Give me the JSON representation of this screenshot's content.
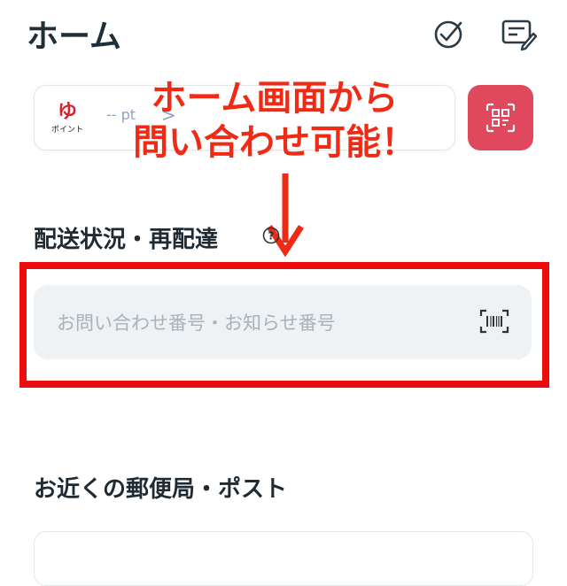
{
  "header": {
    "title": "ホーム",
    "check_icon": "check-circle-icon",
    "edit_icon": "edit-card-icon"
  },
  "points": {
    "logo_mark": "ゆ",
    "logo_text": "ポイント",
    "value": "-- pt",
    "chevron": ">"
  },
  "qr": {
    "icon": "qr-code-icon",
    "color": "#e0485e"
  },
  "callout": {
    "line1": "ホーム画面から",
    "line2": "問い合わせ可能！",
    "color": "#ef2b16"
  },
  "tracking": {
    "label": "配送状況・再配達",
    "help_icon": "question-circle-icon",
    "placeholder": "お問い合わせ番号・お知らせ番号",
    "value": "",
    "barcode_icon": "barcode-scan-icon"
  },
  "nearby": {
    "label": "お近くの郵便局・ポスト"
  },
  "colors": {
    "highlight": "#ee0d0d",
    "title": "#1f2f3a"
  }
}
